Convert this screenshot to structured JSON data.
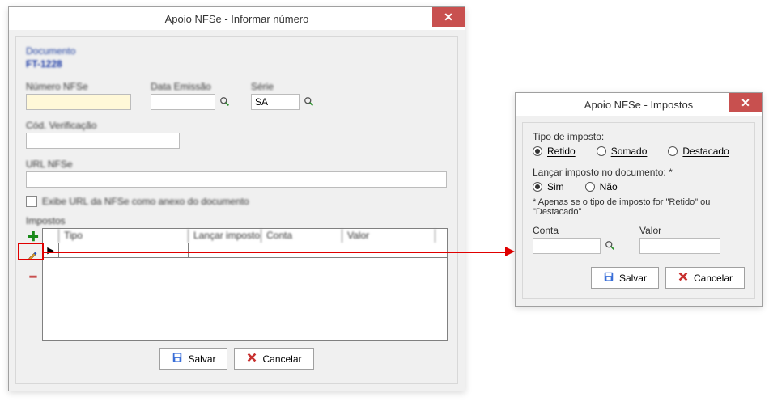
{
  "window1": {
    "title": "Apoio NFSe - Informar número",
    "documento_label": "Documento",
    "documento_value": "FT-1228",
    "numero_label": "Número NFSe",
    "data_label": "Data Emissão",
    "serie_label": "Série",
    "serie_value": "SA",
    "cod_verif_label": "Cód. Verificação",
    "url_label": "URL NFSe",
    "checkbox_label": "Exibe URL da NFSe como anexo do documento",
    "grid_label": "Impostos",
    "headers": {
      "tipo": "Tipo",
      "lancar": "Lançar imposto",
      "conta": "Conta",
      "valor": "Valor"
    },
    "save": "Salvar",
    "cancel": "Cancelar"
  },
  "window2": {
    "title": "Apoio NFSe - Impostos",
    "tipo_label": "Tipo de imposto:",
    "r1": {
      "retido": "Retido",
      "somado": "Somado",
      "destacado": "Destacado"
    },
    "lancar_label": "Lançar imposto no documento: *",
    "r2": {
      "sim": "Sim",
      "nao": "Não"
    },
    "note": "* Apenas se o tipo de imposto for \"Retido\" ou \"Destacado\"",
    "conta_label": "Conta",
    "valor_label": "Valor",
    "save": "Salvar",
    "cancel": "Cancelar"
  }
}
